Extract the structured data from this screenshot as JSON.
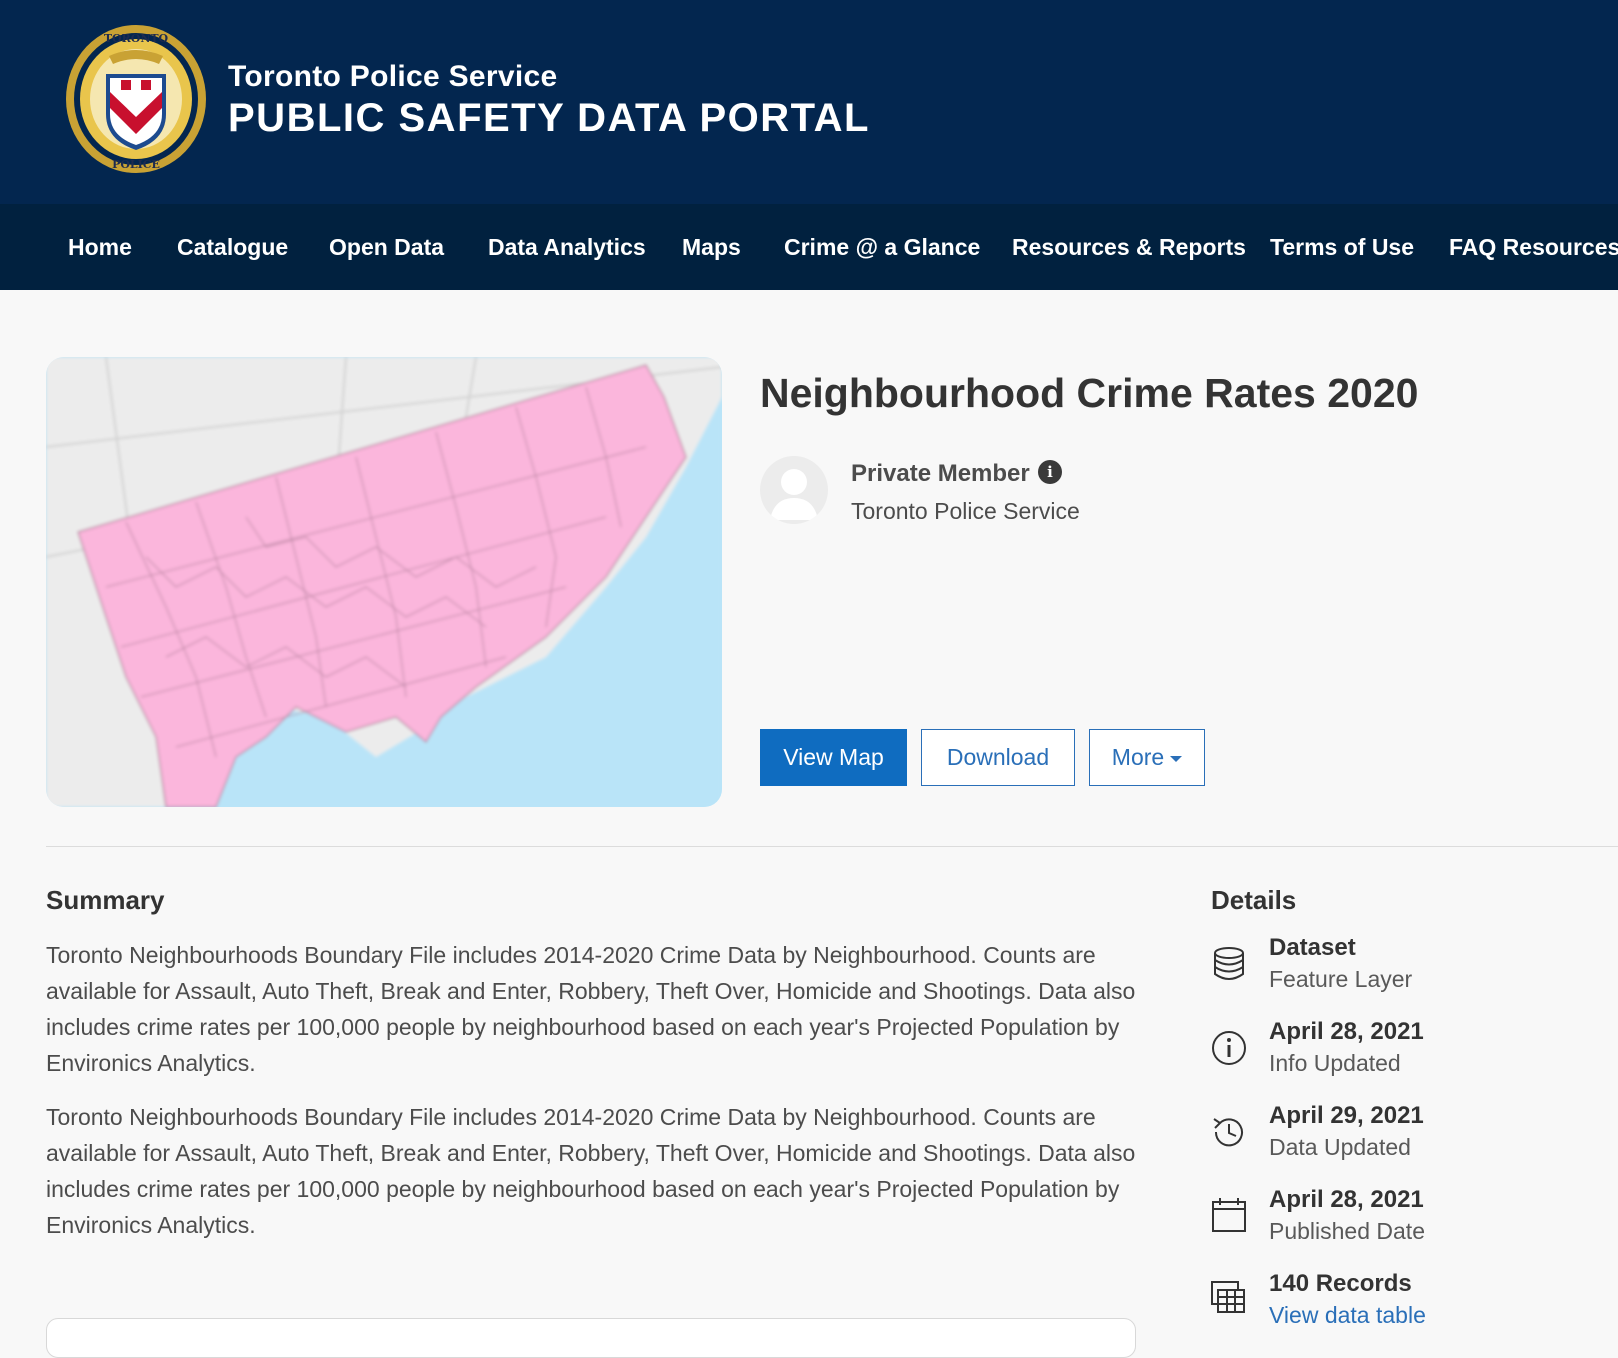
{
  "header": {
    "org_name": "Toronto Police Service",
    "portal_name": "PUBLIC SAFETY DATA PORTAL",
    "logo_text_top": "TORONTO",
    "logo_text_bottom": "POLICE"
  },
  "nav": {
    "items": [
      {
        "label": "Home"
      },
      {
        "label": "Catalogue"
      },
      {
        "label": "Open Data"
      },
      {
        "label": "Data Analytics"
      },
      {
        "label": "Maps"
      },
      {
        "label": "Crime @ a Glance"
      },
      {
        "label": "Resources & Reports"
      },
      {
        "label": "Terms of Use"
      },
      {
        "label": "FAQ Resources"
      }
    ]
  },
  "item": {
    "title": "Neighbourhood Crime Rates 2020",
    "owner_name": "Private Member",
    "owner_org": "Toronto Police Service",
    "info_glyph": "i"
  },
  "actions": {
    "view_map": "View Map",
    "download": "Download",
    "more": "More"
  },
  "summary": {
    "heading": "Summary",
    "paragraphs": [
      "Toronto Neighbourhoods Boundary File includes 2014-2020 Crime Data by Neighbourhood. Counts are available for Assault, Auto Theft, Break and Enter, Robbery, Theft Over, Homicide and Shootings. Data also includes crime rates per 100,000 people by neighbourhood based on each year's Projected Population by Environics Analytics.",
      "Toronto Neighbourhoods Boundary File includes 2014-2020 Crime Data by Neighbourhood. Counts are available for Assault, Auto Theft, Break and Enter, Robbery, Theft Over, Homicide and Shootings. Data also includes crime rates per 100,000 people by neighbourhood based on each year's Projected Population by Environics Analytics."
    ]
  },
  "details": {
    "heading": "Details",
    "rows": [
      {
        "icon": "database-icon",
        "title": "Dataset",
        "sub": "Feature Layer"
      },
      {
        "icon": "info-circle-icon",
        "title": "April 28, 2021",
        "sub": "Info Updated"
      },
      {
        "icon": "history-icon",
        "title": "April 29, 2021",
        "sub": "Data Updated"
      },
      {
        "icon": "calendar-icon",
        "title": "April 28, 2021",
        "sub": "Published Date"
      },
      {
        "icon": "table-icon",
        "title": "140 Records",
        "sub": "View data table"
      }
    ]
  },
  "colors": {
    "header_bg": "#03264f",
    "nav_bg": "#01213f",
    "primary_button": "#0f6cc0",
    "link": "#2a6fb8",
    "map_land_fill": "#fbb6dc",
    "map_water": "#b9e4f8"
  }
}
